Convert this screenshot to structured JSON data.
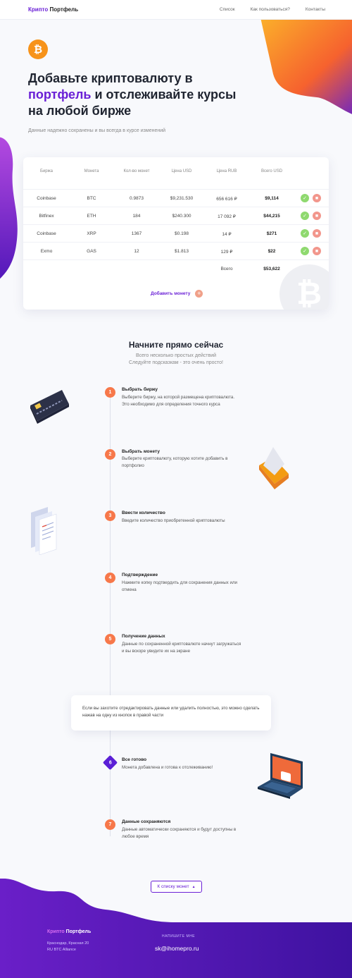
{
  "header": {
    "logo_part1": "Крипто",
    "logo_part2": "Портфель",
    "nav": [
      "Список",
      "Как пользоваться?",
      "Контакты"
    ]
  },
  "hero": {
    "badge_symbol": "₿",
    "title_line1": "Добавьте криптовалюту в",
    "title_highlight": "портфель",
    "title_line2_rest": " и отслеживайте курсы",
    "title_line3": "на любой бирже",
    "subtitle": "Данные надежно сохранены и вы всегда в курсе изменений"
  },
  "table": {
    "headers": [
      "Биржа",
      "Монета",
      "Кол-во монет",
      "Цена USD",
      "Цена RUB",
      "Всего USD"
    ],
    "rows": [
      {
        "exchange": "Coinbase",
        "coin": "BTC",
        "amount": "0.9873",
        "usd": "$9,231.530",
        "rub": "656 616 ₽",
        "total": "$9,114"
      },
      {
        "exchange": "Bitfinex",
        "coin": "ETH",
        "amount": "184",
        "usd": "$240.300",
        "rub": "17 092 ₽",
        "total": "$44,215"
      },
      {
        "exchange": "Coinbase",
        "coin": "XRP",
        "amount": "1367",
        "usd": "$0.198",
        "rub": "14 ₽",
        "total": "$271"
      },
      {
        "exchange": "Exmo",
        "coin": "GAS",
        "amount": "12",
        "usd": "$1.813",
        "rub": "129 ₽",
        "total": "$22"
      }
    ],
    "total_label": "Всего",
    "total_value": "$53,622",
    "add_label": "Добавить монету",
    "add_symbol": "+",
    "ok_symbol": "✓",
    "del_symbol": "■",
    "watermark_symbol": "₿"
  },
  "steps": {
    "title": "Начните прямо сейчас",
    "subtitle_line1": "Всего несколько простых действий",
    "subtitle_line2": "Следуйте подсказкам - это очень просто!",
    "items": [
      {
        "num": "1",
        "title": "Выбрать биржу",
        "desc": "Выберите биржу, на которой размещена криптовалюта. Это необходимо для определения точного курса"
      },
      {
        "num": "2",
        "title": "Выбрать монету",
        "desc": "Выберите криптовалюту, которую хотите добавить в портфолио"
      },
      {
        "num": "3",
        "title": "Ввести количество",
        "desc": "Введите количество приобретенной криптовалюты"
      },
      {
        "num": "4",
        "title": "Подтверждение",
        "desc": "Нажмите копку подтвердить для сохранения данных или отмена"
      },
      {
        "num": "5",
        "title": "Получение данных",
        "desc": "Данные по сохраненной криптовалюте начнут загружаться и вы вскоре увидите их на экране"
      },
      {
        "num": "6",
        "title": "Все готово",
        "desc": "Монета добавлена и готова к отслеживанию!"
      },
      {
        "num": "7",
        "title": "Данные сохраняются",
        "desc": "Данные автоматически сохраняются и будут доступны в любое время"
      }
    ],
    "note": "Если вы захотите отредактировать данные или удалить полностью, это можно сделать нажав на одну из кнопок в правой части",
    "back_label": "К списку монет",
    "back_icon": "▲"
  },
  "footer": {
    "logo_part1": "Крипто",
    "logo_part2": "Портфель",
    "address_line1": "Краснодар, Красная 20",
    "address_line2": "RU BTC Alliance",
    "write_label": "НАПИШИТЕ МНЕ",
    "email": "sk@ihomepro.ru"
  },
  "colors": {
    "accent": "#6a1fd6",
    "orange": "#f7784a",
    "bitcoin": "#f7931a",
    "footer": "#4a14a8"
  }
}
